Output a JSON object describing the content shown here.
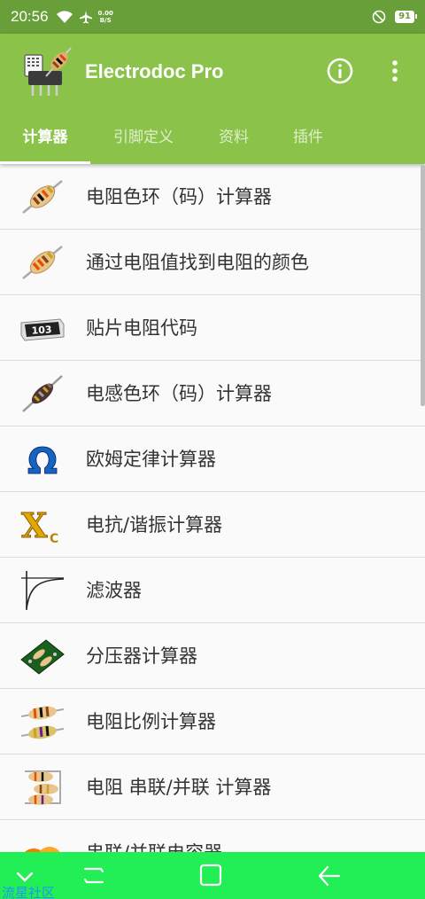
{
  "status_bar": {
    "time": "20:56",
    "net_speed_value": "0.00",
    "net_speed_unit": "B/S",
    "battery": "91"
  },
  "app_bar": {
    "title": "Electrodoc Pro",
    "colors": {
      "status": "#689f38",
      "toolbar": "#8bc34a",
      "nav": "#22ee55"
    }
  },
  "tabs": [
    {
      "label": "计算器",
      "active": true
    },
    {
      "label": "引脚定义",
      "active": false
    },
    {
      "label": "资料",
      "active": false
    },
    {
      "label": "插件",
      "active": false
    }
  ],
  "list": {
    "items": [
      {
        "label": "电阻色环（码）计算器",
        "icon": "resistor-icon"
      },
      {
        "label": "通过电阻值找到电阻的颜色",
        "icon": "resistor-icon"
      },
      {
        "label": "贴片电阻代码",
        "icon": "smd-resistor-icon",
        "icon_text": "103"
      },
      {
        "label": "电感色环（码）计算器",
        "icon": "inductor-icon"
      },
      {
        "label": "欧姆定律计算器",
        "icon": "ohm-icon",
        "icon_text": "Ω"
      },
      {
        "label": "电抗/谐振计算器",
        "icon": "reactance-icon",
        "icon_text": "X",
        "icon_sub": "C"
      },
      {
        "label": "滤波器",
        "icon": "filter-curve-icon"
      },
      {
        "label": "分压器计算器",
        "icon": "voltage-divider-icon"
      },
      {
        "label": "电阻比例计算器",
        "icon": "resistor-ratio-icon"
      },
      {
        "label": "电阻 串联/并联 计算器",
        "icon": "resistor-series-parallel-icon"
      },
      {
        "label": "串联/并联电容器",
        "icon": "capacitor-icon"
      }
    ]
  },
  "nav_bar": {
    "buttons": [
      "chevron-down-icon",
      "menu-lines-icon",
      "home-square-icon",
      "back-arrow-icon"
    ]
  },
  "watermark": "流星社区"
}
